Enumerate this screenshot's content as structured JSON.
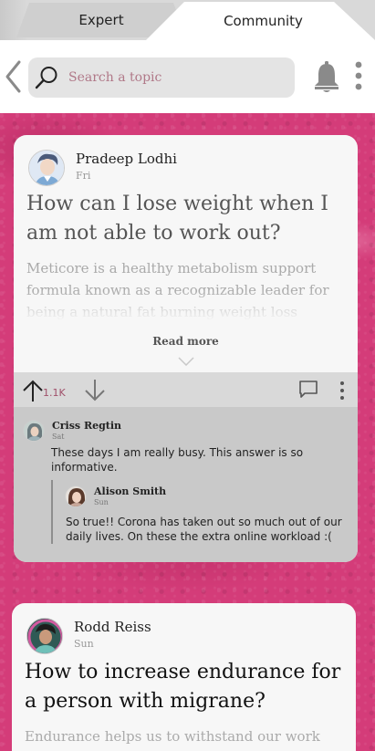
{
  "tabs": [
    {
      "label": "Expert",
      "active": false
    },
    {
      "label": "Community",
      "active": true
    }
  ],
  "search": {
    "placeholder": "Search a topic"
  },
  "icons": {
    "back": "chevron-left-icon",
    "search": "search-icon",
    "notifications": "bell-icon",
    "menu": "more-vertical-icon"
  },
  "colors": {
    "background": "#d43c79",
    "card": "#f7f7f7",
    "action_bar": "#d9d9d9",
    "comments": "#c9c9c9",
    "upvote_count": "#a0506a"
  },
  "posts": [
    {
      "author": "Pradeep Lodhi",
      "day": "Fri",
      "question": "How can I lose weight when I am not able to work out?",
      "answer_preview": "Meticore is a healthy metabolism support formula known as a recognizable leader for being a natural fat burning weight loss",
      "read_more": "Read more",
      "upvotes": "1.1K",
      "comments": [
        {
          "author": "Criss Regtin",
          "day": "Sat",
          "text": "These days I am really busy. This answer is so informative.",
          "replies": [
            {
              "author": "Alison Smith",
              "day": "Sun",
              "text": "So true!! Corona has taken out so much out of our daily lives. On these the extra online workload :("
            }
          ]
        }
      ]
    },
    {
      "author": "Rodd Reiss",
      "day": "Sun",
      "question": "How to increase endurance for a person with migrane?",
      "answer_preview": "Endurance helps us to withstand our work for"
    }
  ]
}
